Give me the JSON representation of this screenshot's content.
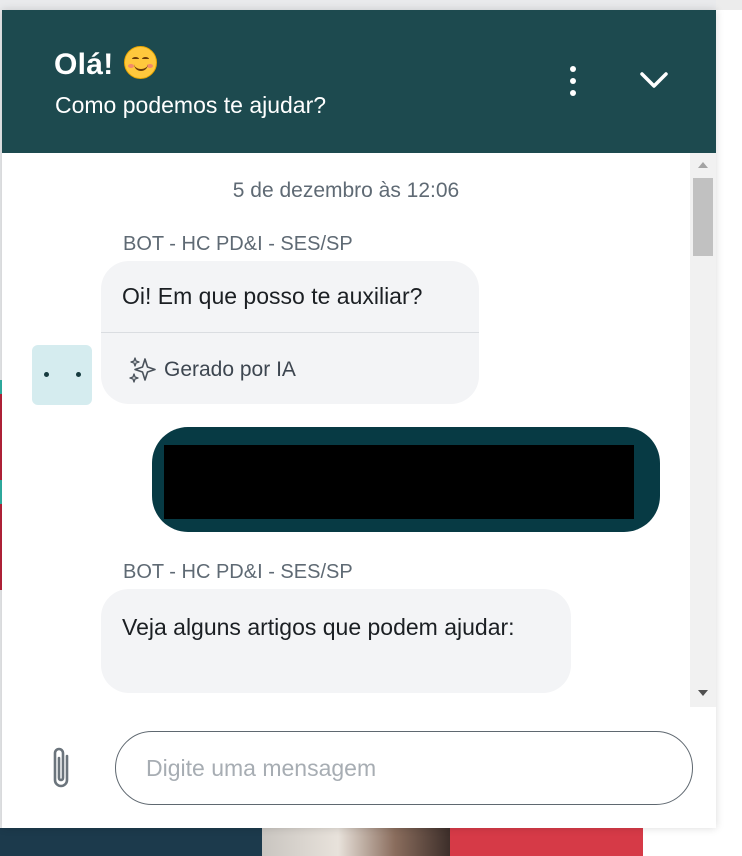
{
  "header": {
    "title": "Olá!",
    "emoji": "smiling-face-icon",
    "subtitle": "Como podemos te ajudar?",
    "menu_icon": "more-vertical-icon",
    "collapse_icon": "chevron-down-icon",
    "background_color": "#1d4a4f"
  },
  "conversation": {
    "timestamp": "5 de dezembro às 12:06",
    "messages": [
      {
        "role": "bot",
        "sender": "BOT - HC PD&I - SES/SP",
        "text": "Oi! Em que posso te auxiliar?",
        "footer": "Gerado por IA",
        "footer_icon": "sparkles-icon"
      },
      {
        "role": "user",
        "text": "",
        "redacted": true,
        "bubble_color": "#073a44"
      },
      {
        "role": "bot",
        "sender": "BOT - HC PD&I - SES/SP",
        "text": "Veja alguns artigos que podem ajudar:"
      }
    ]
  },
  "composer": {
    "placeholder": "Digite uma mensagem",
    "value": "",
    "attach_icon": "paperclip-icon"
  }
}
